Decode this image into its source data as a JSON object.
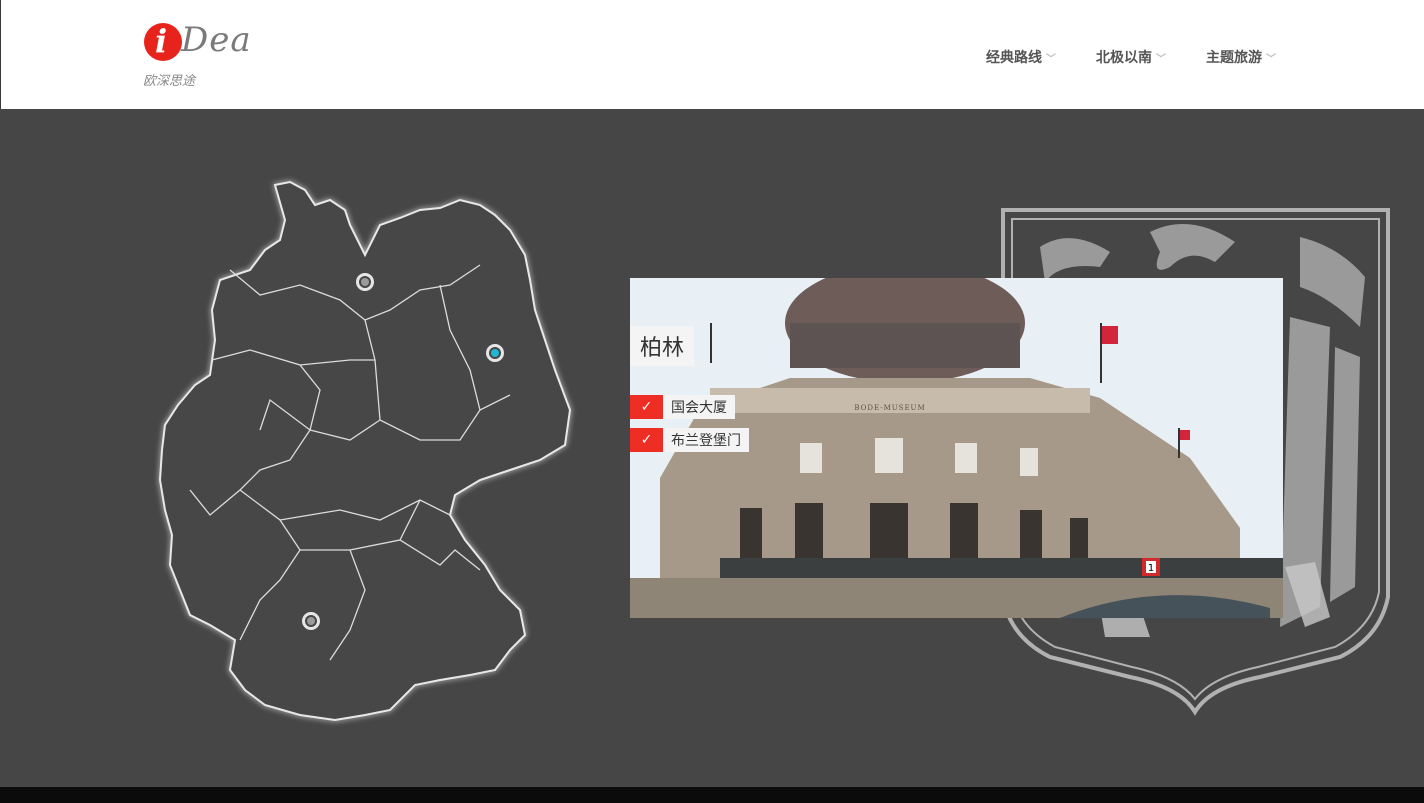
{
  "header": {
    "logo_letter": "i",
    "logo_text": "Dea",
    "logo_subtitle": "欧深思途",
    "nav": [
      {
        "label": "经典路线"
      },
      {
        "label": "北极以南"
      },
      {
        "label": "主题旅游"
      }
    ]
  },
  "city_panel": {
    "city_name": "柏林",
    "points": [
      {
        "label": "国会大厦",
        "checked": true
      },
      {
        "label": "布兰登堡门",
        "checked": true
      }
    ],
    "photo_caption_sign": "1",
    "museum_inscription": "BODE-MUSEUM"
  },
  "map": {
    "markers": [
      {
        "name": "hamburg",
        "active": false
      },
      {
        "name": "berlin",
        "active": true
      },
      {
        "name": "stuttgart",
        "active": false
      }
    ]
  },
  "colors": {
    "accent": "#ee2e24",
    "active_marker": "#20b7d6",
    "background": "#464646"
  }
}
